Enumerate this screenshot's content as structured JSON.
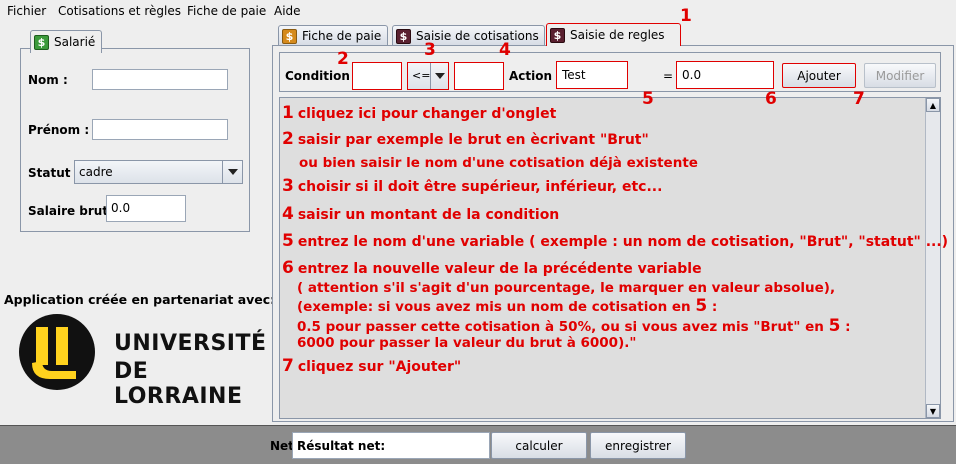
{
  "menu": {
    "items": [
      "Fichier",
      "Cotisations et règles",
      "Fiche de paie",
      "Aide"
    ]
  },
  "left_panel": {
    "tab_label": "Salarié",
    "nom_label": "Nom :",
    "nom_value": "",
    "prenom_label": "Prénom :",
    "prenom_value": "",
    "statut_label": "Statut :",
    "statut_value": "cadre",
    "salaire_label": "Salaire brut :",
    "salaire_value": "0.0"
  },
  "partner": {
    "text": "Application créée en partenariat avec:",
    "logo_line1": "UNIVERSITÉ",
    "logo_line2": "DE LORRAINE"
  },
  "tabs": [
    {
      "label": "Fiche de paie"
    },
    {
      "label": "Saisie de cotisations"
    },
    {
      "label": "Saisie de regles"
    }
  ],
  "rule_form": {
    "condition_label": "Condition :",
    "condition_value": "",
    "operator_value": "<=",
    "amount_value": "",
    "action_label": "Action :",
    "action_value": "Test",
    "equals": "=",
    "new_value": "0.0",
    "add_button": "Ajouter",
    "modify_button": "Modifier"
  },
  "annotations": {
    "n1": "1",
    "n2": "2",
    "n3": "3",
    "n4": "4",
    "n5": "5",
    "n6": "6",
    "n7": "7"
  },
  "instructions": {
    "i1": "cliquez ici pour changer d'onglet",
    "i2a": "saisir par exemple le brut en ècrivant \"Brut\"",
    "i2b": "ou bien saisir le nom d'une cotisation déjà existente",
    "i3": "choisir si il doit être supérieur, inférieur, etc...",
    "i4": "saisir un montant de la condition",
    "i5": "entrez le nom d'une variable ( exemple : un nom de cotisation, \"Brut\", \"statut\" ...)",
    "i6a": "entrez la nouvelle valeur de la précédente variable",
    "i6b": "( attention s'il s'agit d'un pourcentage, le marquer en valeur absolue),",
    "i6c_pre": "(exemple: si vous avez mis un nom de cotisation en",
    "i6c_post": ":",
    "i6d_pre": "0.5 pour passer cette cotisation à 50%, ou si vous avez mis \"Brut\" en",
    "i6d_post": ":",
    "i6e": "6000 pour passer la valeur du brut à 6000).\"",
    "i7": "cliquez sur \"Ajouter\""
  },
  "bottom": {
    "net_label": "Net",
    "result_text": "Résultat net:",
    "calc_button": "calculer",
    "save_button": "enregistrer"
  },
  "colors": {
    "annotation_red": "#e00000",
    "logo_black": "#111111",
    "logo_yellow": "#ffd21e"
  }
}
